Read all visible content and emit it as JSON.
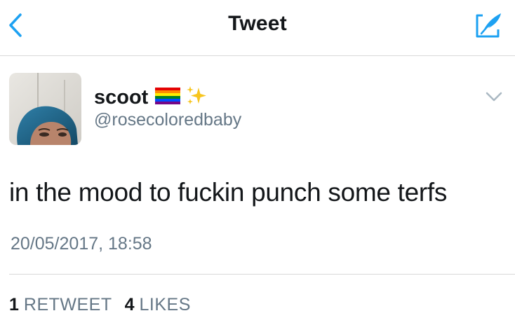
{
  "nav": {
    "title": "Tweet",
    "back_icon": "chevron-left-icon",
    "compose_icon": "compose-tweet-icon",
    "accent_color": "#1da1f2"
  },
  "tweet": {
    "display_name": "scoot",
    "name_emojis": [
      "rainbow-flag-icon",
      "sparkles-icon"
    ],
    "handle": "@rosecoloredbaby",
    "text": "in the mood to fuckin punch some terfs",
    "timestamp": "20/05/2017, 18:58",
    "caret_icon": "chevron-down-icon"
  },
  "stats": {
    "retweets_count": "1",
    "retweets_label": "RETWEET",
    "likes_count": "4",
    "likes_label": "LIKES"
  }
}
